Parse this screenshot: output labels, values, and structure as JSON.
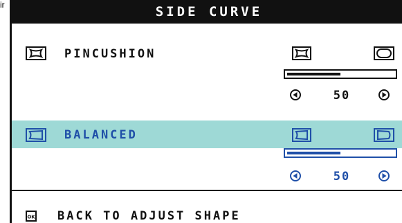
{
  "fragment": "ir",
  "title": "SIDE CURVE",
  "colors": {
    "highlight": "#9ed9d6",
    "accent": "#1f4fa8",
    "dark": "#111111"
  },
  "options": [
    {
      "label": "PINCUSHION",
      "icon": "pincushion-icon",
      "left_icon": "pincushion-shape-icon",
      "right_icon": "barrel-shape-icon",
      "value": "50",
      "level": 0.5,
      "selected": false
    },
    {
      "label": "BALANCED",
      "icon": "balanced-icon",
      "left_icon": "balanced-left-icon",
      "right_icon": "balanced-right-icon",
      "value": "50",
      "level": 0.5,
      "selected": true
    }
  ],
  "back": {
    "label": "BACK TO ADJUST SHAPE",
    "icon": "ok-icon"
  }
}
